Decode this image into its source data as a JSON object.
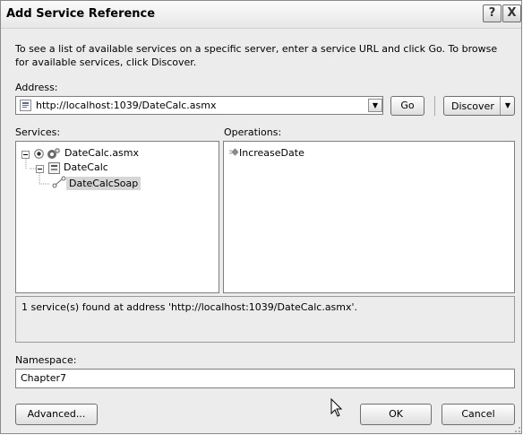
{
  "window": {
    "title": "Add Service Reference",
    "help_button": "?",
    "close_button": "X"
  },
  "intro_text": "To see a list of available services on a specific server, enter a service URL and click Go. To browse for available services, click Discover.",
  "address": {
    "label": "Address:",
    "value": "http://localhost:1039/DateCalc.asmx",
    "go_label": "Go",
    "discover_label": "Discover"
  },
  "services": {
    "label": "Services:",
    "tree": {
      "root": "DateCalc.asmx",
      "child": "DateCalc",
      "grandchild": "DateCalcSoap"
    }
  },
  "operations": {
    "label": "Operations:",
    "items": [
      "IncreaseDate"
    ]
  },
  "status_text": "1 service(s) found at address 'http://localhost:1039/DateCalc.asmx'.",
  "namespace": {
    "label": "Namespace:",
    "value": "Chapter7"
  },
  "buttons": {
    "advanced": "Advanced...",
    "ok": "OK",
    "cancel": "Cancel"
  },
  "icons": {
    "expand": "collapse-box-icon",
    "radio": "radio-selected-icon",
    "service": "service-gears-icon",
    "class": "class-icon",
    "endpoint": "endpoint-icon",
    "operation": "operation-icon",
    "page": "page-icon"
  },
  "colors": {
    "selection": "#d6d6d6",
    "dialog_bg": "#ececec"
  }
}
